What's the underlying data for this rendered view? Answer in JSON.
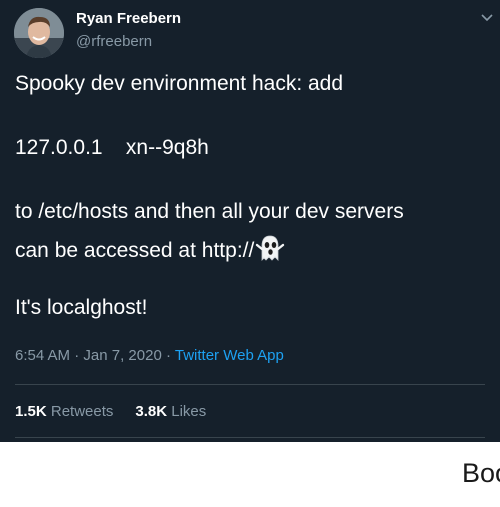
{
  "tweet": {
    "author_name": "Ryan Freebern",
    "author_handle": "@rfreebern",
    "lines": {
      "line1": "Spooky dev environment hack: add",
      "line2": "127.0.0.1    xn--9q8h",
      "line3": "to /etc/hosts and then all your dev servers",
      "line4": "can be accessed at http://",
      "line4_icon": "ghost-emoji",
      "line5": "It's localghost!"
    },
    "time": "6:54 AM",
    "separator": "·",
    "date": "Jan 7, 2020",
    "source": "Twitter Web App",
    "retweets_count": "1.5K",
    "retweets_label": "Retweets",
    "likes_count": "3.8K",
    "likes_label": "Likes"
  },
  "caption": "Boo..",
  "colors": {
    "background": "#15202b",
    "secondary_text": "#8899a6",
    "link": "#1da1f2",
    "divider": "#38444d"
  }
}
